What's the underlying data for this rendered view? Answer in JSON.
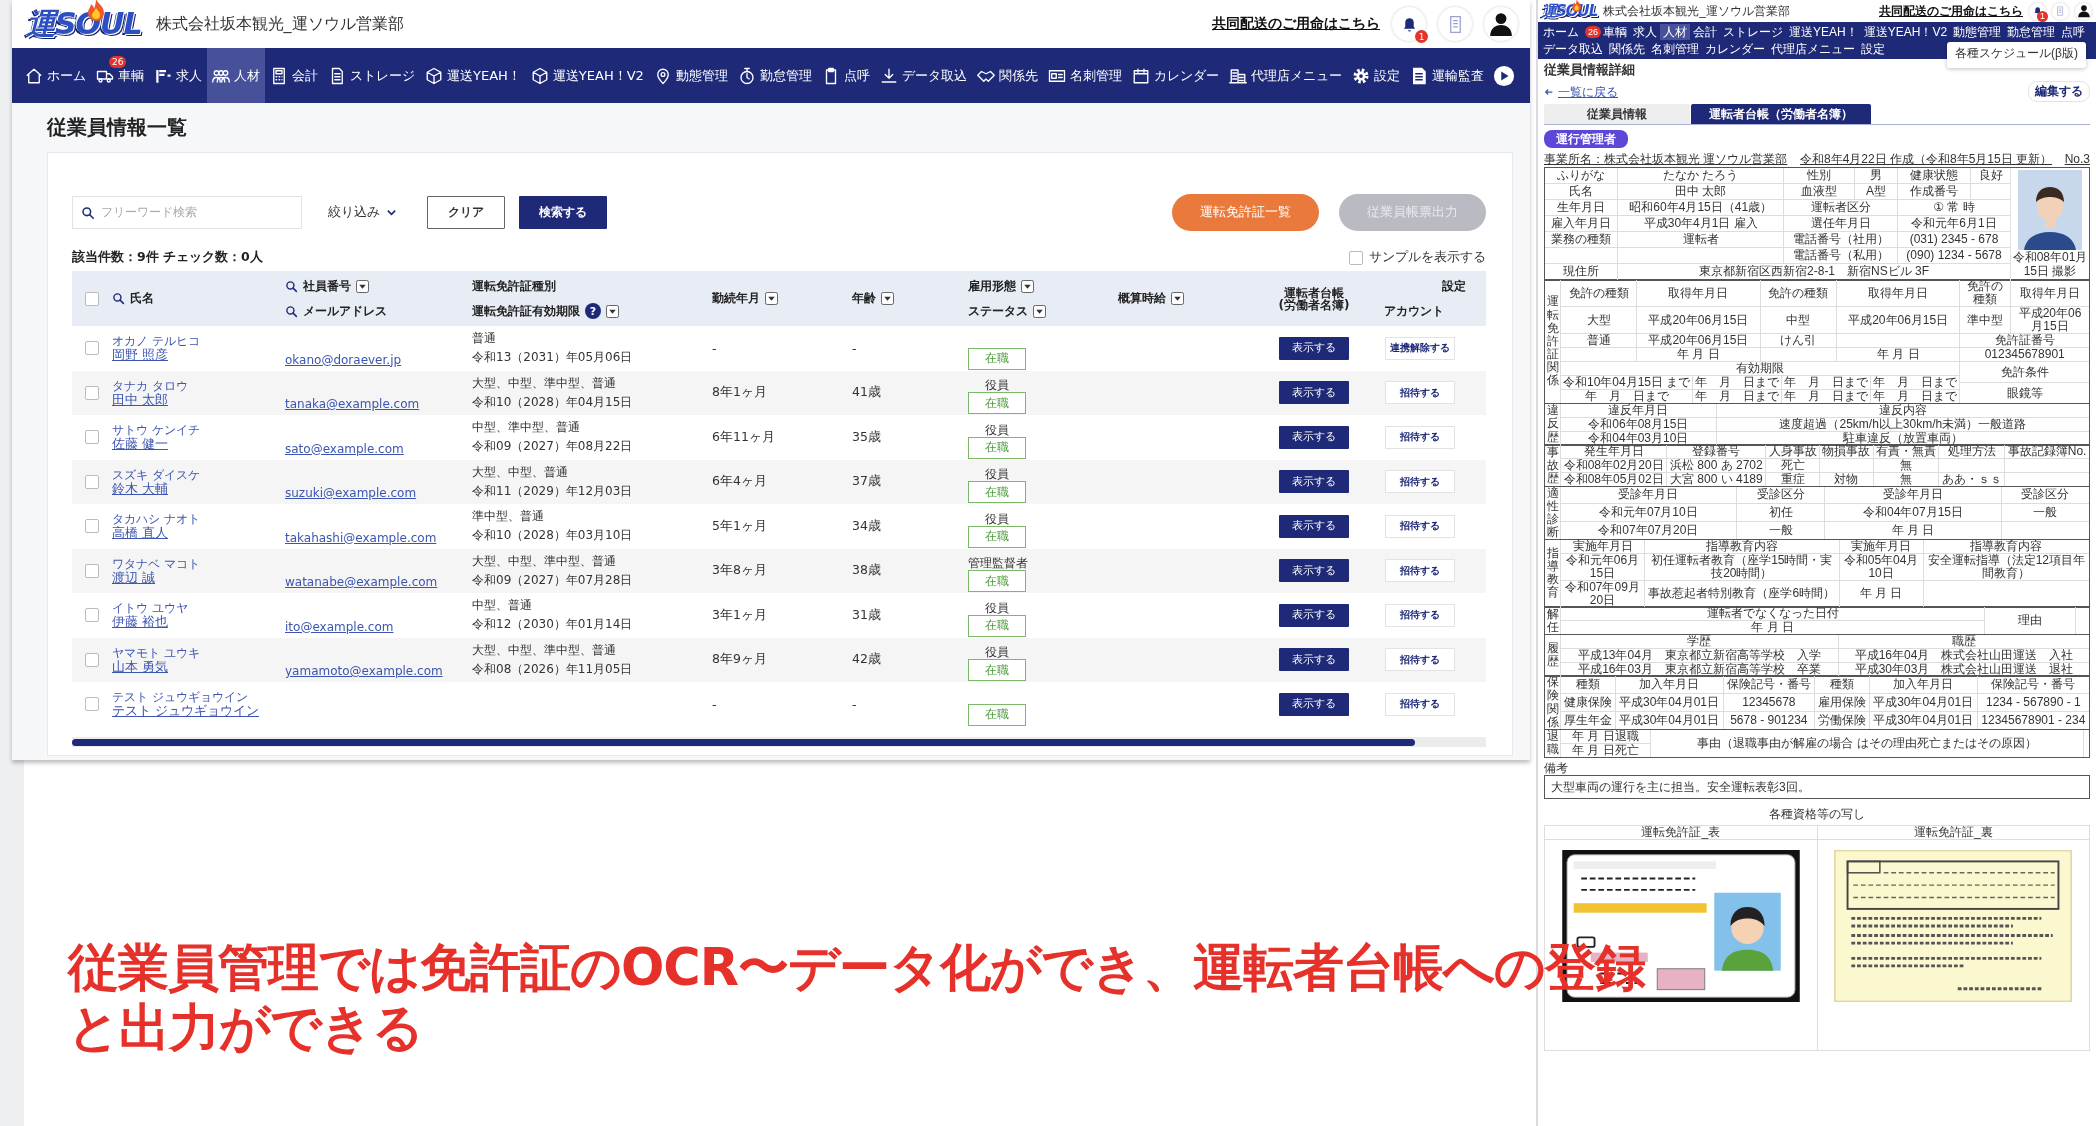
{
  "main": {
    "header": {
      "logo": "運SOUL",
      "company": "株式会社坂本観光_運ソウル営業部",
      "link": "共同配送のご用命はこちら",
      "bell_badge": "1"
    },
    "nav": [
      {
        "label": "ホーム",
        "selected": false
      },
      {
        "label": "車輌",
        "selected": false,
        "badge": "26"
      },
      {
        "label": "求人",
        "selected": false
      },
      {
        "label": "人材",
        "selected": true
      },
      {
        "label": "会計",
        "selected": false
      },
      {
        "label": "ストレージ",
        "selected": false
      },
      {
        "label": "運送YEAH！",
        "selected": false
      },
      {
        "label": "運送YEAH！V2",
        "selected": false
      },
      {
        "label": "動態管理",
        "selected": false
      },
      {
        "label": "勤怠管理",
        "selected": false
      },
      {
        "label": "点呼",
        "selected": false
      },
      {
        "label": "データ取込",
        "selected": false
      },
      {
        "label": "関係先",
        "selected": false
      },
      {
        "label": "名刺管理",
        "selected": false
      },
      {
        "label": "カレンダー",
        "selected": false
      },
      {
        "label": "代理店メニュー",
        "selected": false
      },
      {
        "label": "設定",
        "selected": false
      },
      {
        "label": "運輸監査",
        "selected": false
      }
    ],
    "title": "従業員情報一覧",
    "search": {
      "placeholder": "フリーワード検索"
    },
    "filter": "絞り込み",
    "buttons": [
      {
        "label": "クリア",
        "kind": "outline"
      },
      {
        "label": "検索する",
        "kind": "primary"
      }
    ],
    "pills": [
      {
        "label": "運転免許証一覧",
        "disabled": false
      },
      {
        "label": "従業員帳票出力",
        "disabled": true
      }
    ],
    "count": "該当件数：9件 チェック数：0人",
    "sample": {
      "label": "サンプルを表示する",
      "checked": false
    },
    "all_checked": false,
    "columns": [
      [
        {
          "text": "氏名",
          "search": true,
          "filter": false
        }
      ],
      [
        {
          "text": "社員番号",
          "search": true,
          "filter": true
        },
        {
          "text": "メールアドレス",
          "search": true,
          "filter": false
        }
      ],
      [
        {
          "text": "運転免許証種別",
          "search": false,
          "filter": false
        },
        {
          "text": "運転免許証有効期限",
          "search": false,
          "filter": true,
          "help": "?"
        }
      ],
      [
        {
          "text": "勤続年月",
          "search": false,
          "filter": true
        }
      ],
      [
        {
          "text": "年齢",
          "search": false,
          "filter": true
        }
      ],
      [
        {
          "text": "雇用形態",
          "search": false,
          "filter": true
        },
        {
          "text": "ステータス",
          "search": false,
          "filter": true
        }
      ],
      [
        {
          "text": "概算時給",
          "search": false,
          "filter": true
        }
      ],
      [
        {
          "text": "運転者台帳",
          "search": false,
          "filter": false
        },
        {
          "text": "(労働者名簿)",
          "search": false,
          "filter": false
        }
      ],
      [
        {
          "text": "設定",
          "search": false,
          "filter": false
        },
        {
          "text": "アカウント",
          "search": false,
          "filter": false
        }
      ]
    ],
    "rows": [
      {
        "checked": false,
        "kana": "オカノ テルヒコ",
        "name": "岡野 照彦",
        "email": "okano@doraever.jp",
        "license": "普通",
        "expiry": "令和13（2031）年05月06日",
        "tenure": "-",
        "age": "-",
        "status": "在職",
        "view": "表示する",
        "account": "連携解除する"
      },
      {
        "checked": false,
        "kana": "タナカ タロウ",
        "name": "田中 太郎",
        "email": "tanaka@example.com",
        "license": "大型、中型、準中型、普通",
        "expiry": "令和10（2028）年04月15日",
        "tenure": "8年1ヶ月",
        "age": "41歳",
        "employment": "役員",
        "status": "在職",
        "view": "表示する",
        "account": "招待する"
      },
      {
        "checked": false,
        "kana": "サトウ ケンイチ",
        "name": "佐藤 健一",
        "email": "sato@example.com",
        "license": "中型、準中型、普通",
        "expiry": "令和09（2027）年08月22日",
        "tenure": "6年11ヶ月",
        "age": "35歳",
        "employment": "役員",
        "status": "在職",
        "view": "表示する",
        "account": "招待する"
      },
      {
        "checked": false,
        "kana": "スズキ ダイスケ",
        "name": "鈴木 大輔",
        "email": "suzuki@example.com",
        "license": "大型、中型、普通",
        "expiry": "令和11（2029）年12月03日",
        "tenure": "6年4ヶ月",
        "age": "37歳",
        "employment": "役員",
        "status": "在職",
        "view": "表示する",
        "account": "招待する"
      },
      {
        "checked": false,
        "kana": "タカハシ ナオト",
        "name": "高橋 直人",
        "email": "takahashi@example.com",
        "license": "準中型、普通",
        "expiry": "令和10（2028）年03月10日",
        "tenure": "5年1ヶ月",
        "age": "34歳",
        "employment": "役員",
        "status": "在職",
        "view": "表示する",
        "account": "招待する"
      },
      {
        "checked": false,
        "kana": "ワタナベ マコト",
        "name": "渡辺 誠",
        "email": "watanabe@example.com",
        "license": "大型、中型、準中型、普通",
        "expiry": "令和09（2027）年07月28日",
        "tenure": "3年8ヶ月",
        "age": "38歳",
        "employment": "管理監督者",
        "status": "在職",
        "view": "表示する",
        "account": "招待する"
      },
      {
        "checked": false,
        "kana": "イトウ ユウヤ",
        "name": "伊藤 裕也",
        "email": "ito@example.com",
        "license": "中型、普通",
        "expiry": "令和12（2030）年01月14日",
        "tenure": "3年1ヶ月",
        "age": "31歳",
        "employment": "役員",
        "status": "在職",
        "view": "表示する",
        "account": "招待する"
      },
      {
        "checked": false,
        "kana": "ヤマモト ユウキ",
        "name": "山本 勇気",
        "email": "yamamoto@example.com",
        "license": "大型、中型、準中型、普通",
        "expiry": "令和08（2026）年11月05日",
        "tenure": "8年9ヶ月",
        "age": "42歳",
        "employment": "役員",
        "status": "在職",
        "view": "表示する",
        "account": "招待する"
      },
      {
        "checked": false,
        "kana": "テスト ジュウギョウイン",
        "name": "テスト ジュウギョウイン",
        "tenure": "-",
        "age": "-",
        "status": "在職",
        "view": "表示する",
        "account": "招待する"
      }
    ]
  },
  "detail": {
    "header": {
      "logo": "運SOUL",
      "company": "株式会社坂本観光_運ソウル営業部",
      "link": "共同配送のご用命はこちら",
      "bell_badge": "1"
    },
    "nav": [
      {
        "label": "ホーム",
        "selected": false
      },
      {
        "label": "車輌",
        "selected": false,
        "badge": "26"
      },
      {
        "label": "求人",
        "selected": false
      },
      {
        "label": "人材",
        "selected": true
      },
      {
        "label": "会計",
        "selected": false
      },
      {
        "label": "ストレージ",
        "selected": false
      },
      {
        "label": "運送YEAH！",
        "selected": false
      },
      {
        "label": "運送YEAH！V2",
        "selected": false
      },
      {
        "label": "動態管理",
        "selected": false
      },
      {
        "label": "勤怠管理",
        "selected": false
      },
      {
        "label": "点呼",
        "selected": false
      },
      {
        "label": "データ取込",
        "selected": false
      },
      {
        "label": "関係先",
        "selected": false
      },
      {
        "label": "名刺管理",
        "selected": false
      },
      {
        "label": "カレンダー",
        "selected": false
      },
      {
        "label": "代理店メニュー",
        "selected": false
      },
      {
        "label": "設定",
        "selected": false
      }
    ],
    "menu_item": "各種スケジュール(β版)",
    "title": "従業員情報詳細",
    "back": "一覧に戻る",
    "edit": "編集する",
    "tabs": [
      {
        "label": "従業員情報",
        "selected": false
      },
      {
        "label": "運転者台帳（労働者名簿）",
        "selected": true
      }
    ],
    "role": "運行管理者",
    "office": "事業所名：株式会社坂本観光 運ソウル営業部",
    "dates": "令和8年4月22日 作成（令和8年5月15日 更新）",
    "number": "No.3",
    "profile": {
      "rows": [
        [
          "ふりがな",
          "たなか たろう",
          "性別",
          "男",
          "健康状態",
          "良好"
        ],
        [
          "氏名",
          "田中 太郎",
          "血液型",
          "A型",
          "作成番号",
          ""
        ],
        [
          "生年月日",
          "昭和60年4月15日（41歳）",
          {
            "t": "運転者区分",
            "colspan": 2
          },
          {
            "t": "① 常 時",
            "colspan": 2
          }
        ],
        [
          "雇入年月日",
          "平成30年4月1日 雇入",
          {
            "t": "選任年月日",
            "colspan": 2
          },
          {
            "t": "令和元年6月1日",
            "colspan": 2
          }
        ],
        [
          "業務の種類",
          "運転者",
          {
            "t": "電話番号（社用）",
            "colspan": 2
          },
          {
            "t": "(031) 2345 - 678",
            "colspan": 2
          }
        ],
        [
          "",
          "",
          {
            "t": "電話番号（私用）",
            "colspan": 2
          },
          {
            "t": "(090) 1234 - 5678",
            "colspan": 2
          }
        ]
      ],
      "photo_caption": "令和08年01月15日 撮影",
      "address": [
        "現住所",
        {
          "t": "東京都新宿区西新宿2-8-1　新宿NSビル 3F",
          "colspan": 5
        }
      ]
    },
    "sections": [
      {
        "label": "運転免許証関係",
        "rows": [
          [
            "免許の種類",
            "取得年月日",
            "免許の種類",
            "取得年月日",
            "免許の種類",
            "取得年月日"
          ],
          [
            "大型",
            "平成20年06月15日",
            "中型",
            "平成20年06月15日",
            "準中型",
            "平成20年06月15日"
          ],
          [
            "普通",
            "平成20年06月15日",
            "けん引",
            "",
            {
              "t": "免許証番号",
              "colspan": 2
            }
          ],
          [
            "",
            "年 月 日",
            "",
            "年 月 日",
            {
              "t": "012345678901",
              "colspan": 2
            }
          ],
          [
            {
              "stack": [
                [
                  {
                    "t": "有効期限",
                    "colspan": 4
                  }
                ],
                [
                  "令和10年04月15日 まで",
                  "年　月　日まで",
                  "年　月　日まで",
                  "年　月　日まで"
                ],
                [
                  "年　月　日まで",
                  "年　月　日まで",
                  "年　月　日まで",
                  "年　月　日まで"
                ]
              ],
              "colspan": 4
            },
            {
              "stack": [
                [
                  "免許条件"
                ],
                [
                  "眼鏡等"
                ]
              ],
              "colspan": 2
            }
          ]
        ]
      },
      {
        "label": "違反歴",
        "rows": [
          [
            "違反年月日",
            "違反内容"
          ],
          [
            "令和06年08月15日",
            "速度超過（25km/h以上30km/h未満）一般道路"
          ],
          [
            "令和04年03月10日",
            "駐車違反（放置車両）"
          ]
        ]
      },
      {
        "label": "事故歴",
        "rows": [
          [
            "発生年月日",
            "登録番号",
            "人身事故",
            "物損事故",
            "有責・無責",
            "処理方法",
            "事故記録簿No."
          ],
          [
            "令和08年02月20日",
            "浜松 800 あ 2702",
            "死亡",
            "",
            "無",
            "",
            ""
          ],
          [
            "令和08年05月02日",
            "大宮 800 い 4189",
            "重症",
            "対物",
            "無",
            "ああ・ｓｓ",
            ""
          ]
        ]
      },
      {
        "label": "適性診断",
        "rows": [
          [
            "受診年月日",
            "受診区分",
            "受診年月日",
            "受診区分"
          ],
          [
            "令和元年07月10日",
            "初任",
            "令和04年07月15日",
            "一般"
          ],
          [
            "令和07年07月20日",
            "一般",
            "年 月 日",
            ""
          ]
        ]
      },
      {
        "label": "指導教育",
        "rows": [
          [
            "実施年月日",
            "指導教育内容",
            "実施年月日",
            "指導教育内容"
          ],
          [
            "令和元年06月15日",
            "初任運転者教育（座学15時間・実技20時間）",
            "令和05年04月10日",
            "安全運転指導（法定12項目年間教育）"
          ],
          [
            "令和07年09月20日",
            "事故惹起者特別教育（座学6時間）",
            "年 月 日",
            ""
          ]
        ]
      },
      {
        "label": "解任",
        "rows": [
          [
            {
              "stack": [
                [
                  "運転者でなくなった日付"
                ],
                [
                  "年 月 日"
                ]
              ]
            },
            "理由",
            ""
          ]
        ]
      },
      {
        "label": "履歴",
        "rows": [
          [
            "学歴",
            "職歴"
          ],
          [
            "平成13年04月　東京都立新宿高等学校　入学",
            "平成16年04月　株式会社山田運送　入社"
          ],
          [
            "平成16年03月　東京都立新宿高等学校　卒業",
            "平成30年03月　株式会社山田運送　退社"
          ]
        ]
      },
      {
        "label": "保険関係",
        "rows": [
          [
            "種類",
            "加入年月日",
            "保険記号・番号",
            "種類",
            "加入年月日",
            "保険記号・番号"
          ],
          [
            "健康保険",
            "平成30年04月01日",
            "12345678",
            "雇用保険",
            "平成30年04月01日",
            "1234 - 567890 - 1"
          ],
          [
            "厚生年金",
            "平成30年04月01日",
            "5678 - 901234",
            "労働保険",
            "平成30年04月01日",
            "12345678901 - 234"
          ]
        ]
      },
      {
        "label": "退職",
        "rows": [
          [
            {
              "stack": [
                [
                  "年 月 日退職"
                ],
                [
                  "年 月 日死亡"
                ]
              ]
            },
            "事由（退職事由が解雇の場合 はその理由死亡またはその原因）",
            ""
          ]
        ]
      }
    ],
    "remarks_label": "備考",
    "remarks": "大型車両の運行を主に担当。安全運転表彰3回。",
    "copies_title": "各種資格等の写し",
    "copies": [
      {
        "label": "運転免許証_表",
        "kind": "front"
      },
      {
        "label": "運転免許証_裏",
        "kind": "back"
      }
    ]
  },
  "caption": [
    "従業員管理では免許証のOCR〜データ化ができ、運転者台帳への登録",
    "と出力ができる"
  ]
}
